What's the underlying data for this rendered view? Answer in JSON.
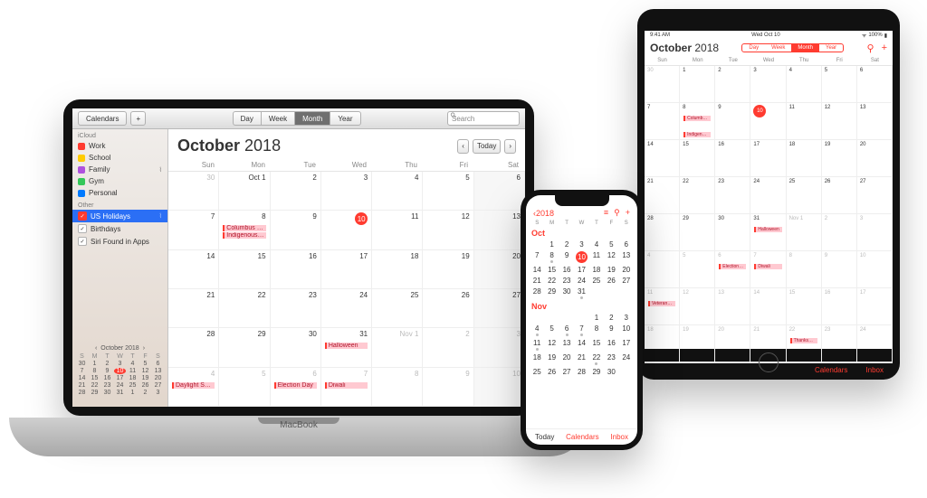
{
  "mac": {
    "toolbar": {
      "calendars_label": "Calendars",
      "segments": [
        "Day",
        "Week",
        "Month",
        "Year"
      ],
      "active_segment": "Month",
      "search_placeholder": "Search"
    },
    "sidebar": {
      "sections": {
        "icloud": {
          "label": "iCloud",
          "items": [
            {
              "label": "Work",
              "color": "#ff3b30"
            },
            {
              "label": "School",
              "color": "#ffcc00"
            },
            {
              "label": "Family",
              "color": "#af52de",
              "broadcast": true
            },
            {
              "label": "Gym",
              "color": "#34c759"
            },
            {
              "label": "Personal",
              "color": "#007aff"
            }
          ]
        },
        "other": {
          "label": "Other",
          "items": [
            {
              "label": "US Holidays",
              "selected": true,
              "broadcast": true
            },
            {
              "label": "Birthdays"
            },
            {
              "label": "Siri Found in Apps"
            }
          ]
        }
      },
      "mini": {
        "month": "October 2018",
        "dow": [
          "S",
          "M",
          "T",
          "W",
          "T",
          "F",
          "S"
        ],
        "days": [
          30,
          1,
          2,
          3,
          4,
          5,
          6,
          7,
          8,
          9,
          10,
          11,
          12,
          13,
          14,
          15,
          16,
          17,
          18,
          19,
          20,
          21,
          22,
          23,
          24,
          25,
          26,
          27,
          28,
          29,
          30,
          31,
          1,
          2,
          3
        ],
        "today": 10
      }
    },
    "main": {
      "month_strong": "October",
      "month_year": "2018",
      "today_label": "Today",
      "dow": [
        "Sun",
        "Mon",
        "Tue",
        "Wed",
        "Thu",
        "Fri",
        "Sat"
      ],
      "grid": [
        [
          {
            "d": "30",
            "grey": true
          },
          {
            "d": "Oct 1"
          },
          {
            "d": "2"
          },
          {
            "d": "3"
          },
          {
            "d": "4"
          },
          {
            "d": "5"
          },
          {
            "d": "6",
            "sat": true
          }
        ],
        [
          {
            "d": "7"
          },
          {
            "d": "8",
            "ev": [
              "Columbus Day",
              "Indigenous Peo…"
            ]
          },
          {
            "d": "9"
          },
          {
            "d": "10",
            "today": true
          },
          {
            "d": "11"
          },
          {
            "d": "12"
          },
          {
            "d": "13",
            "sat": true
          }
        ],
        [
          {
            "d": "14"
          },
          {
            "d": "15"
          },
          {
            "d": "16"
          },
          {
            "d": "17"
          },
          {
            "d": "18"
          },
          {
            "d": "19"
          },
          {
            "d": "20",
            "sat": true
          }
        ],
        [
          {
            "d": "21"
          },
          {
            "d": "22"
          },
          {
            "d": "23"
          },
          {
            "d": "24"
          },
          {
            "d": "25"
          },
          {
            "d": "26"
          },
          {
            "d": "27",
            "sat": true
          }
        ],
        [
          {
            "d": "28"
          },
          {
            "d": "29"
          },
          {
            "d": "30"
          },
          {
            "d": "31",
            "ev": [
              "Halloween"
            ]
          },
          {
            "d": "Nov 1",
            "grey": true
          },
          {
            "d": "2",
            "grey": true
          },
          {
            "d": "3",
            "grey": true,
            "sat": true
          }
        ],
        [
          {
            "d": "4",
            "grey": true,
            "ev": [
              "Daylight Saving…"
            ]
          },
          {
            "d": "5",
            "grey": true
          },
          {
            "d": "6",
            "grey": true,
            "ev": [
              "Election Day"
            ]
          },
          {
            "d": "7",
            "grey": true,
            "ev": [
              "Diwali"
            ]
          },
          {
            "d": "8",
            "grey": true
          },
          {
            "d": "9",
            "grey": true
          },
          {
            "d": "10",
            "grey": true,
            "sat": true
          }
        ]
      ]
    }
  },
  "ipad": {
    "status": {
      "time": "9:41 AM",
      "date": "Wed Oct 10",
      "battery": "100%"
    },
    "month_strong": "October",
    "month_year": "2018",
    "segments": [
      "Day",
      "Week",
      "Month",
      "Year"
    ],
    "active_segment": "Month",
    "dow": [
      "Sun",
      "Mon",
      "Tue",
      "Wed",
      "Thu",
      "Fri",
      "Sat"
    ],
    "grid": [
      [
        {
          "d": "30",
          "grey": true
        },
        {
          "d": "1"
        },
        {
          "d": "2"
        },
        {
          "d": "3"
        },
        {
          "d": "4"
        },
        {
          "d": "5"
        },
        {
          "d": "6"
        }
      ],
      [
        {
          "d": "7"
        },
        {
          "d": "8",
          "ev": [
            "Columbus Day",
            "Indigenous Peop…"
          ]
        },
        {
          "d": "9"
        },
        {
          "d": "10",
          "today": true
        },
        {
          "d": "11"
        },
        {
          "d": "12"
        },
        {
          "d": "13"
        }
      ],
      [
        {
          "d": "14"
        },
        {
          "d": "15"
        },
        {
          "d": "16"
        },
        {
          "d": "17"
        },
        {
          "d": "18"
        },
        {
          "d": "19"
        },
        {
          "d": "20"
        }
      ],
      [
        {
          "d": "21"
        },
        {
          "d": "22"
        },
        {
          "d": "23"
        },
        {
          "d": "24"
        },
        {
          "d": "25"
        },
        {
          "d": "26"
        },
        {
          "d": "27"
        }
      ],
      [
        {
          "d": "28"
        },
        {
          "d": "29"
        },
        {
          "d": "30"
        },
        {
          "d": "31",
          "ev": [
            "Halloween"
          ]
        },
        {
          "d": "Nov 1",
          "grey": true
        },
        {
          "d": "2",
          "grey": true
        },
        {
          "d": "3",
          "grey": true
        }
      ],
      [
        {
          "d": "4",
          "grey": true
        },
        {
          "d": "5",
          "grey": true
        },
        {
          "d": "6",
          "grey": true,
          "ev": [
            "Election Day"
          ]
        },
        {
          "d": "7",
          "grey": true,
          "ev": [
            "Diwali"
          ]
        },
        {
          "d": "8",
          "grey": true
        },
        {
          "d": "9",
          "grey": true
        },
        {
          "d": "10",
          "grey": true
        }
      ],
      [
        {
          "d": "11",
          "grey": true,
          "ev": [
            "Veterans Day (o…"
          ]
        },
        {
          "d": "12",
          "grey": true
        },
        {
          "d": "13",
          "grey": true
        },
        {
          "d": "14",
          "grey": true
        },
        {
          "d": "15",
          "grey": true
        },
        {
          "d": "16",
          "grey": true
        },
        {
          "d": "17",
          "grey": true
        }
      ],
      [
        {
          "d": "18",
          "grey": true
        },
        {
          "d": "19",
          "grey": true
        },
        {
          "d": "20",
          "grey": true
        },
        {
          "d": "21",
          "grey": true
        },
        {
          "d": "22",
          "grey": true,
          "ev": [
            "Thanksgiving"
          ]
        },
        {
          "d": "23",
          "grey": true
        },
        {
          "d": "24",
          "grey": true
        }
      ]
    ],
    "bottom": {
      "calendars": "Calendars",
      "inbox": "Inbox"
    }
  },
  "iphone": {
    "back": "2018",
    "dow": [
      "S",
      "M",
      "T",
      "W",
      "T",
      "F",
      "S"
    ],
    "months": [
      {
        "name": "Oct",
        "lead": 1,
        "days": 31,
        "today": 10,
        "dots": [
          8,
          31
        ]
      },
      {
        "name": "Nov",
        "lead": 4,
        "days": 30,
        "dots": [
          4,
          6,
          7,
          11,
          22
        ]
      }
    ],
    "bottom": {
      "today": "Today",
      "calendars": "Calendars",
      "inbox": "Inbox"
    }
  }
}
